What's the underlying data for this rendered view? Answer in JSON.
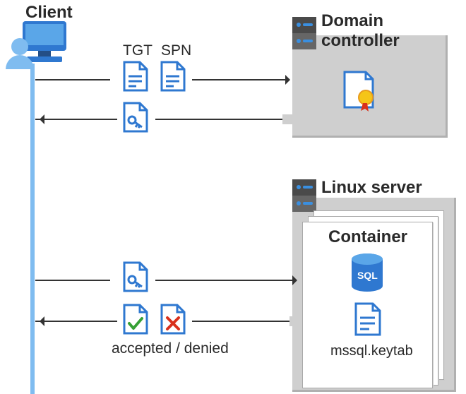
{
  "labels": {
    "client": "Client",
    "domain_controller_l1": "Domain",
    "domain_controller_l2": "controller",
    "linux_server": "Linux server",
    "container": "Container",
    "tgt": "TGT",
    "spn": "SPN",
    "accepted_denied": "accepted / denied",
    "keytab": "mssql.keytab",
    "sql_text": "SQL"
  },
  "flow": {
    "steps": [
      "Client sends TGT + SPN to Domain Controller",
      "Domain Controller returns service ticket (key) to Client",
      "Client sends service ticket to Linux server container",
      "Container responds accepted / denied"
    ]
  },
  "colors": {
    "blue": "#2f78d0",
    "light_blue": "#7fbcf0",
    "gray": "#cfcfcf",
    "red": "#d9301c",
    "green": "#36a035",
    "orange": "#e89b1e",
    "yellow": "#f5c518"
  }
}
